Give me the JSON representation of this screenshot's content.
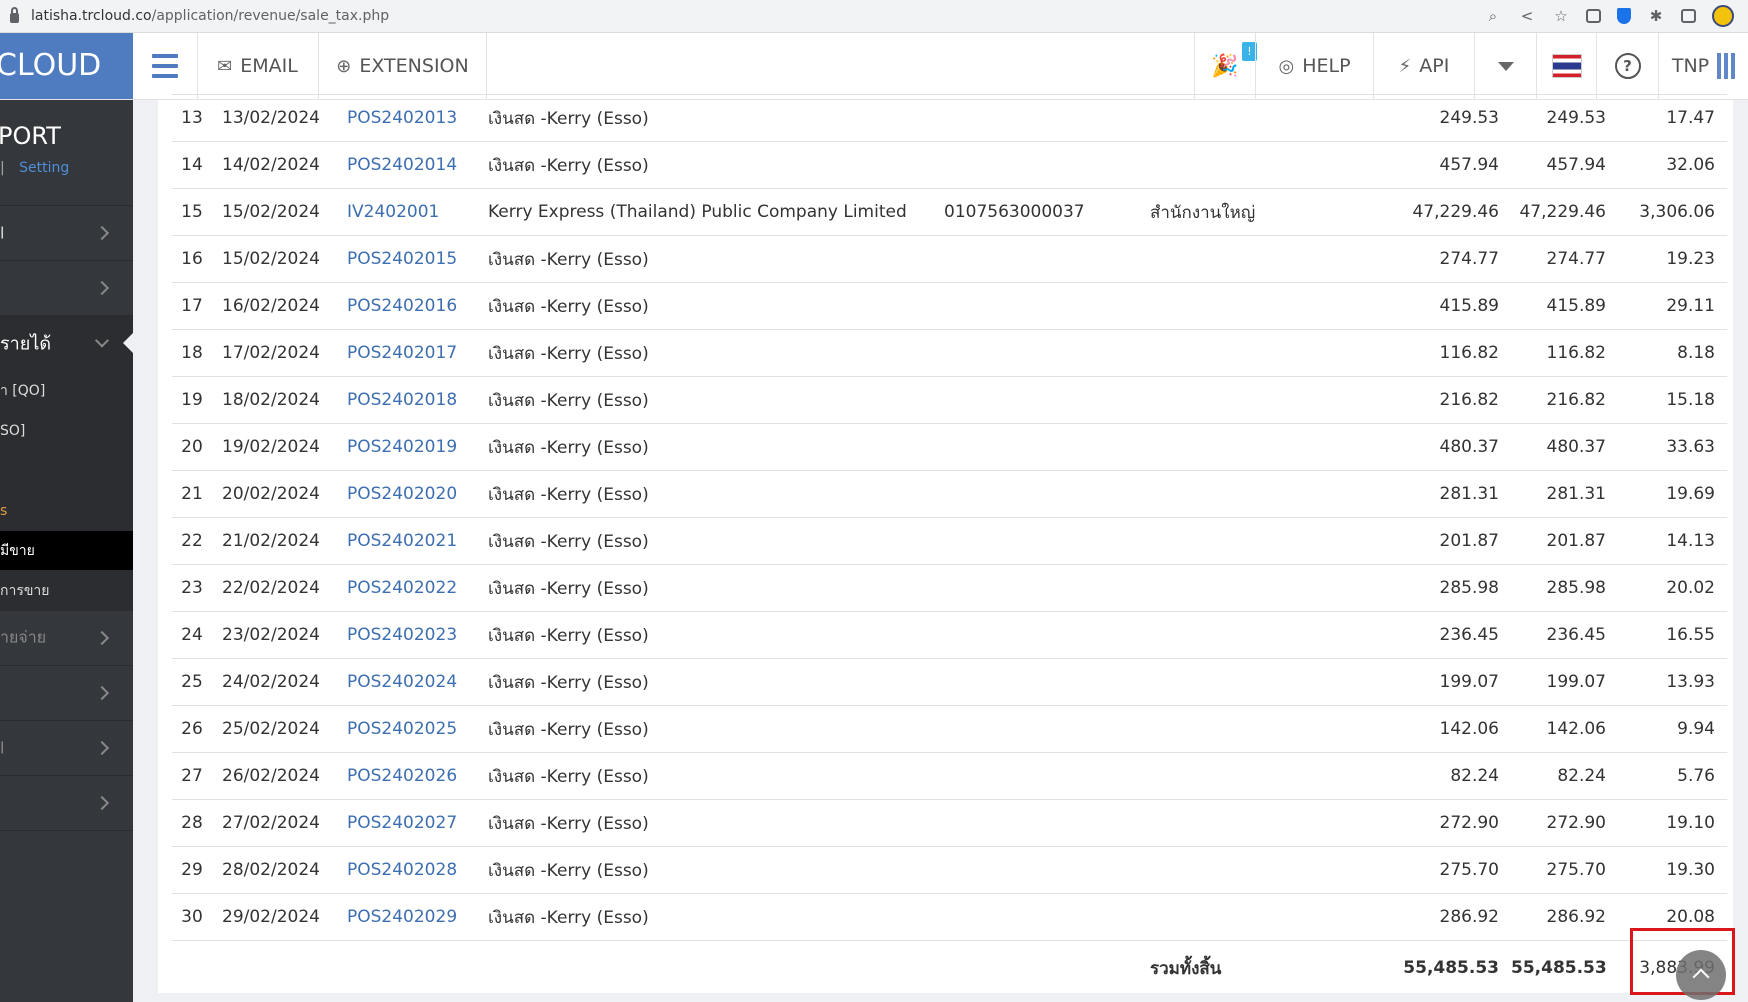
{
  "browser": {
    "url_domain": "latisha.trcloud.co",
    "url_path": "/application/revenue/sale_tax.php"
  },
  "topnav": {
    "brand": "CLOUD",
    "email": "EMAIL",
    "extension": "EXTENSION",
    "badge": "!",
    "help": "HELP",
    "api": "API",
    "user": "TNP",
    "brand_color": "#4f7bc1"
  },
  "sidebar": {
    "title": "PORT",
    "setting_sep": "|",
    "setting": "Setting",
    "items": [
      {
        "label": "l"
      },
      {
        "label": ""
      },
      {
        "label": "รายได้"
      },
      {
        "label": "า [QO]"
      },
      {
        "label": "SO]"
      },
      {
        "label": ""
      },
      {
        "label": "s"
      },
      {
        "label": "มีขาย"
      },
      {
        "label": "การขาย"
      },
      {
        "label": "ายจ่าย"
      },
      {
        "label": ""
      },
      {
        "label": "l"
      },
      {
        "label": ""
      }
    ]
  },
  "table": {
    "rows": [
      {
        "no": "13",
        "date": "13/02/2024",
        "doc": "POS2402013",
        "name": "เงินสด -Kerry (Esso)",
        "taxid": "",
        "branch": "",
        "a": "249.53",
        "b": "249.53",
        "vat": "17.47"
      },
      {
        "no": "14",
        "date": "14/02/2024",
        "doc": "POS2402014",
        "name": "เงินสด -Kerry (Esso)",
        "taxid": "",
        "branch": "",
        "a": "457.94",
        "b": "457.94",
        "vat": "32.06"
      },
      {
        "no": "15",
        "date": "15/02/2024",
        "doc": "IV2402001",
        "name": "Kerry Express (Thailand) Public Company Limited",
        "taxid": "0107563000037",
        "branch": "สำนักงานใหญ่",
        "a": "47,229.46",
        "b": "47,229.46",
        "vat": "3,306.06"
      },
      {
        "no": "16",
        "date": "15/02/2024",
        "doc": "POS2402015",
        "name": "เงินสด -Kerry (Esso)",
        "taxid": "",
        "branch": "",
        "a": "274.77",
        "b": "274.77",
        "vat": "19.23"
      },
      {
        "no": "17",
        "date": "16/02/2024",
        "doc": "POS2402016",
        "name": "เงินสด -Kerry (Esso)",
        "taxid": "",
        "branch": "",
        "a": "415.89",
        "b": "415.89",
        "vat": "29.11"
      },
      {
        "no": "18",
        "date": "17/02/2024",
        "doc": "POS2402017",
        "name": "เงินสด -Kerry (Esso)",
        "taxid": "",
        "branch": "",
        "a": "116.82",
        "b": "116.82",
        "vat": "8.18"
      },
      {
        "no": "19",
        "date": "18/02/2024",
        "doc": "POS2402018",
        "name": "เงินสด -Kerry (Esso)",
        "taxid": "",
        "branch": "",
        "a": "216.82",
        "b": "216.82",
        "vat": "15.18"
      },
      {
        "no": "20",
        "date": "19/02/2024",
        "doc": "POS2402019",
        "name": "เงินสด -Kerry (Esso)",
        "taxid": "",
        "branch": "",
        "a": "480.37",
        "b": "480.37",
        "vat": "33.63"
      },
      {
        "no": "21",
        "date": "20/02/2024",
        "doc": "POS2402020",
        "name": "เงินสด -Kerry (Esso)",
        "taxid": "",
        "branch": "",
        "a": "281.31",
        "b": "281.31",
        "vat": "19.69"
      },
      {
        "no": "22",
        "date": "21/02/2024",
        "doc": "POS2402021",
        "name": "เงินสด -Kerry (Esso)",
        "taxid": "",
        "branch": "",
        "a": "201.87",
        "b": "201.87",
        "vat": "14.13"
      },
      {
        "no": "23",
        "date": "22/02/2024",
        "doc": "POS2402022",
        "name": "เงินสด -Kerry (Esso)",
        "taxid": "",
        "branch": "",
        "a": "285.98",
        "b": "285.98",
        "vat": "20.02"
      },
      {
        "no": "24",
        "date": "23/02/2024",
        "doc": "POS2402023",
        "name": "เงินสด -Kerry (Esso)",
        "taxid": "",
        "branch": "",
        "a": "236.45",
        "b": "236.45",
        "vat": "16.55"
      },
      {
        "no": "25",
        "date": "24/02/2024",
        "doc": "POS2402024",
        "name": "เงินสด -Kerry (Esso)",
        "taxid": "",
        "branch": "",
        "a": "199.07",
        "b": "199.07",
        "vat": "13.93"
      },
      {
        "no": "26",
        "date": "25/02/2024",
        "doc": "POS2402025",
        "name": "เงินสด -Kerry (Esso)",
        "taxid": "",
        "branch": "",
        "a": "142.06",
        "b": "142.06",
        "vat": "9.94"
      },
      {
        "no": "27",
        "date": "26/02/2024",
        "doc": "POS2402026",
        "name": "เงินสด -Kerry (Esso)",
        "taxid": "",
        "branch": "",
        "a": "82.24",
        "b": "82.24",
        "vat": "5.76"
      },
      {
        "no": "28",
        "date": "27/02/2024",
        "doc": "POS2402027",
        "name": "เงินสด -Kerry (Esso)",
        "taxid": "",
        "branch": "",
        "a": "272.90",
        "b": "272.90",
        "vat": "19.10"
      },
      {
        "no": "29",
        "date": "28/02/2024",
        "doc": "POS2402028",
        "name": "เงินสด -Kerry (Esso)",
        "taxid": "",
        "branch": "",
        "a": "275.70",
        "b": "275.70",
        "vat": "19.30"
      },
      {
        "no": "30",
        "date": "29/02/2024",
        "doc": "POS2402029",
        "name": "เงินสด -Kerry (Esso)",
        "taxid": "",
        "branch": "",
        "a": "286.92",
        "b": "286.92",
        "vat": "20.08"
      }
    ],
    "total": {
      "label": "รวมทั้งสิ้น",
      "a": "55,485.53",
      "b": "55,485.53",
      "vat": "3,883.99"
    },
    "link_color": "#3d6fb0",
    "highlight_color": "#d9161c"
  }
}
